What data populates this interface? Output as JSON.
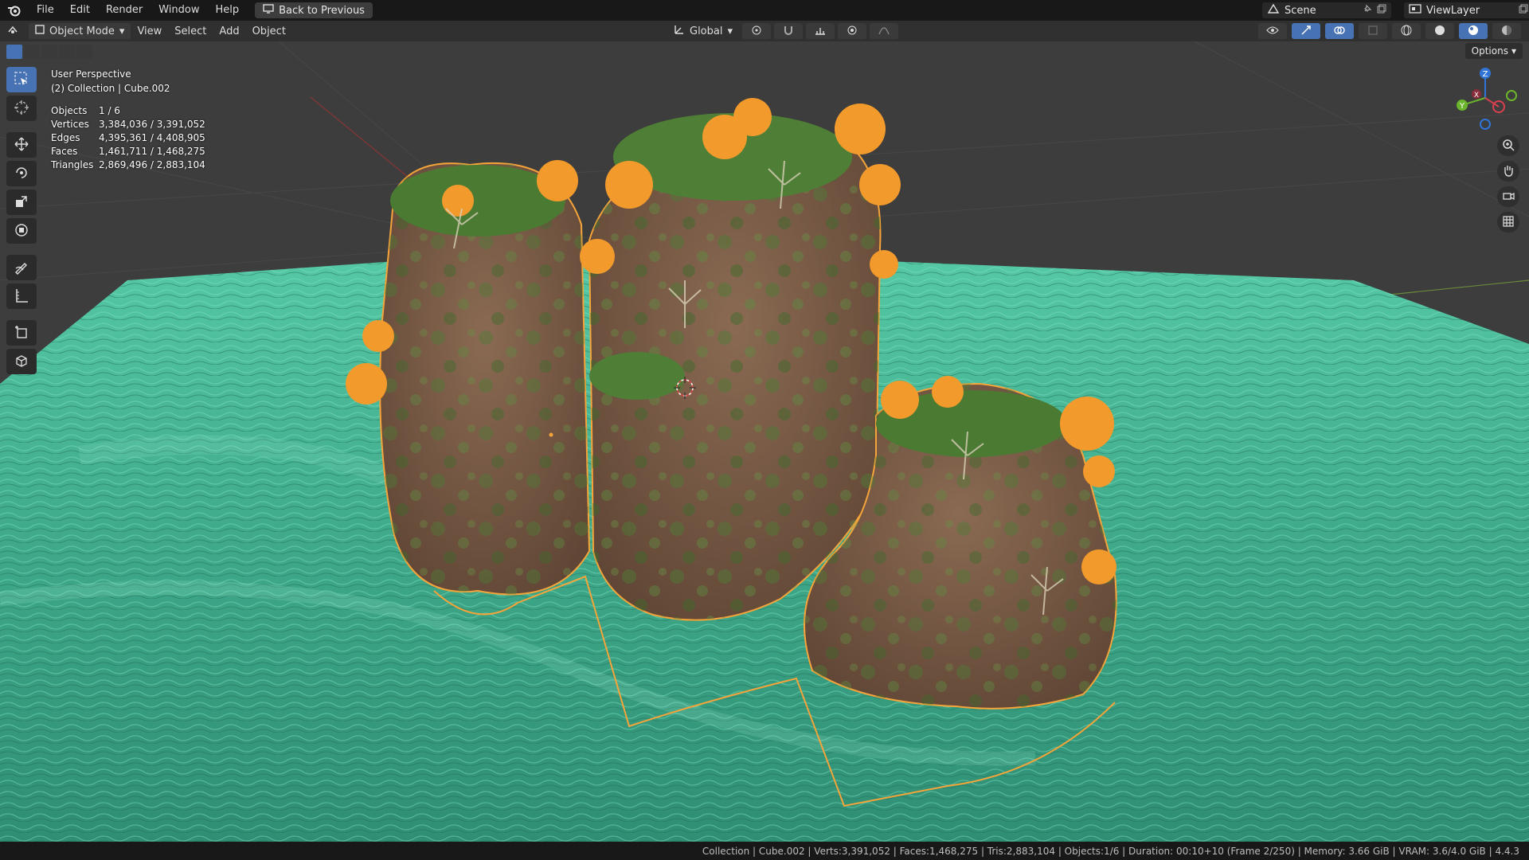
{
  "menubar": {
    "items": [
      "File",
      "Edit",
      "Render",
      "Window",
      "Help"
    ],
    "back_button": "Back to Previous",
    "scene_label": "Scene",
    "viewlayer_label": "ViewLayer"
  },
  "header": {
    "mode": "Object Mode",
    "menus": [
      "View",
      "Select",
      "Add",
      "Object"
    ],
    "orientation": "Global",
    "options_label": "Options"
  },
  "viewport": {
    "perspective_label": "User Perspective",
    "collection_label": "(2) Collection | Cube.002",
    "stats": [
      {
        "label": "Objects",
        "value": "1 / 6"
      },
      {
        "label": "Vertices",
        "value": "3,384,036 / 3,391,052"
      },
      {
        "label": "Edges",
        "value": "4,395,361 / 4,408,905"
      },
      {
        "label": "Faces",
        "value": "1,461,711 / 1,468,275"
      },
      {
        "label": "Triangles",
        "value": "2,869,496 / 2,883,104"
      }
    ],
    "gizmo_axes": {
      "x": "X",
      "y": "Y",
      "z": "Z"
    }
  },
  "statusbar": {
    "text": "Collection | Cube.002 | Verts:3,391,052 | Faces:1,468,275 | Tris:2,883,104 | Objects:1/6 | Duration: 00:10+10 (Frame 2/250) | Memory: 3.66 GiB | VRAM: 3.6/4.0 GiB | 4.4.3"
  },
  "colors": {
    "selection_outline": "#f5a43a",
    "water": "#3fa98a",
    "rock": "#7a5a46",
    "moss": "#4f7a35",
    "active_tool": "#4772b3"
  }
}
